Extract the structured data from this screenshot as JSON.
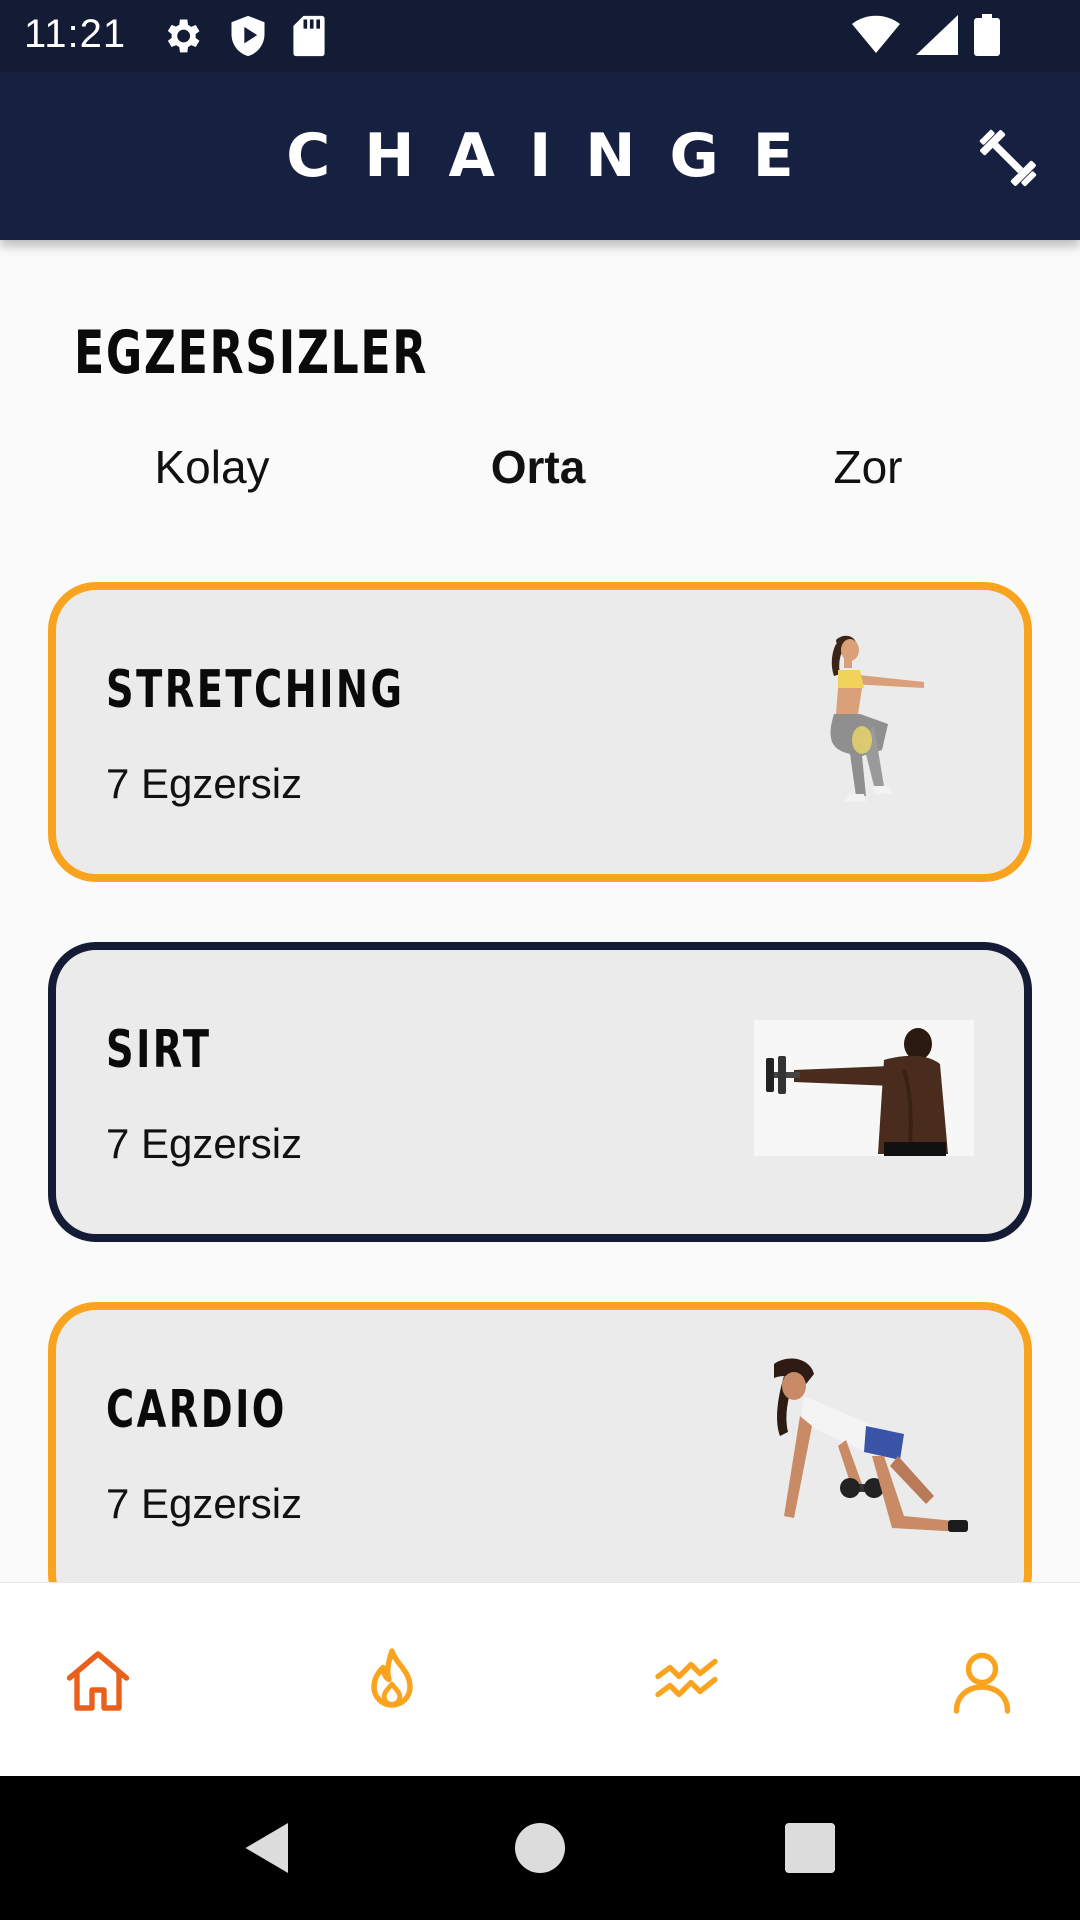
{
  "status_bar": {
    "time": "11:21",
    "left_icons": [
      "gear-icon",
      "shield-play-icon",
      "sd-card-icon"
    ],
    "right_icons": [
      "wifi-icon",
      "signal-icon",
      "battery-icon"
    ]
  },
  "app_bar": {
    "title": "CHAINGE",
    "action_icon": "dumbbell-icon"
  },
  "section": {
    "title": "EGZERSIZLER"
  },
  "tabs": [
    {
      "label": "Kolay",
      "active": false
    },
    {
      "label": "Orta",
      "active": true
    },
    {
      "label": "Zor",
      "active": false
    }
  ],
  "cards": [
    {
      "title": "STRETCHING",
      "subtitle": "7 Egzersiz",
      "image": "squat-woman-photo",
      "border_color": "#f9a31e"
    },
    {
      "title": "SIRT",
      "subtitle": "7 Egzersiz",
      "image": "back-dumbbell-man-photo",
      "border_color": "#141c35"
    },
    {
      "title": "CARDIO",
      "subtitle": "7 Egzersiz",
      "image": "dumbbell-row-woman-photo",
      "border_color": "#f9a31e"
    }
  ],
  "bottom_nav": {
    "items": [
      {
        "icon": "home-icon",
        "color": "#e8601c"
      },
      {
        "icon": "flame-icon",
        "color": "#f9a31e"
      },
      {
        "icon": "activity-icon",
        "color": "#f9a31e"
      },
      {
        "icon": "user-icon",
        "color": "#f9a31e"
      }
    ]
  },
  "system_nav": [
    "back-icon",
    "home-circle-icon",
    "recents-icon"
  ],
  "colors": {
    "primary_dark": "#141c35",
    "accent": "#f9a31e",
    "accent_active": "#e8601c"
  }
}
